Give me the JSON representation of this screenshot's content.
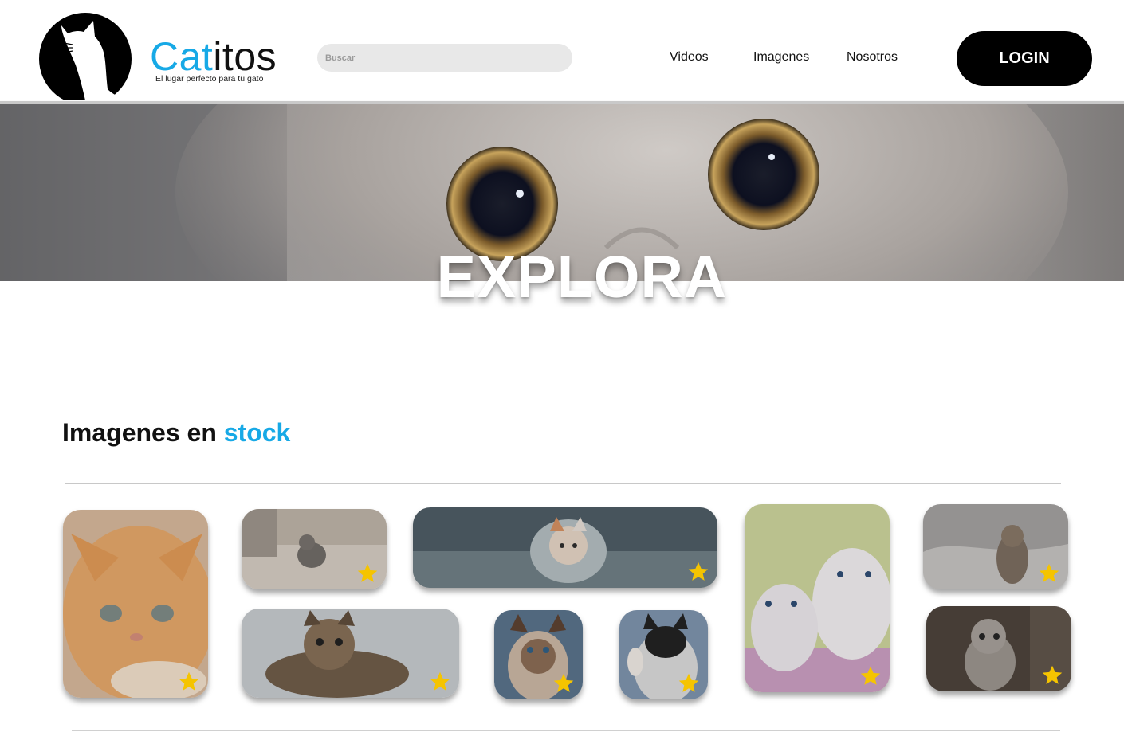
{
  "header": {
    "brand_part1": "Cat",
    "brand_part2": "itos",
    "tagline": "El lugar perfecto para tu gato",
    "search_placeholder": "Buscar",
    "nav": [
      "Videos",
      "Imagenes",
      "Nosotros"
    ],
    "login_label": "LOGIN",
    "logo_icon": "cat-silhouette-icon"
  },
  "hero": {
    "title": "EXPLORA"
  },
  "section": {
    "title_part1": "Imagenes en ",
    "title_part2": "stock"
  },
  "gallery": {
    "favorite_icon": "star-icon",
    "items": [
      {
        "name": "orange-kitten"
      },
      {
        "name": "grey-kitten-floor"
      },
      {
        "name": "kitten-blanket"
      },
      {
        "name": "white-kittens"
      },
      {
        "name": "tabby-kitten-bed"
      },
      {
        "name": "tabby-kitten-lying"
      },
      {
        "name": "siamese-kitten"
      },
      {
        "name": "black-white-kitten"
      },
      {
        "name": "grey-tabby-kitten"
      }
    ]
  },
  "colors": {
    "accent": "#17a9e6",
    "star": "#f5c400",
    "login_bg": "#000000"
  }
}
